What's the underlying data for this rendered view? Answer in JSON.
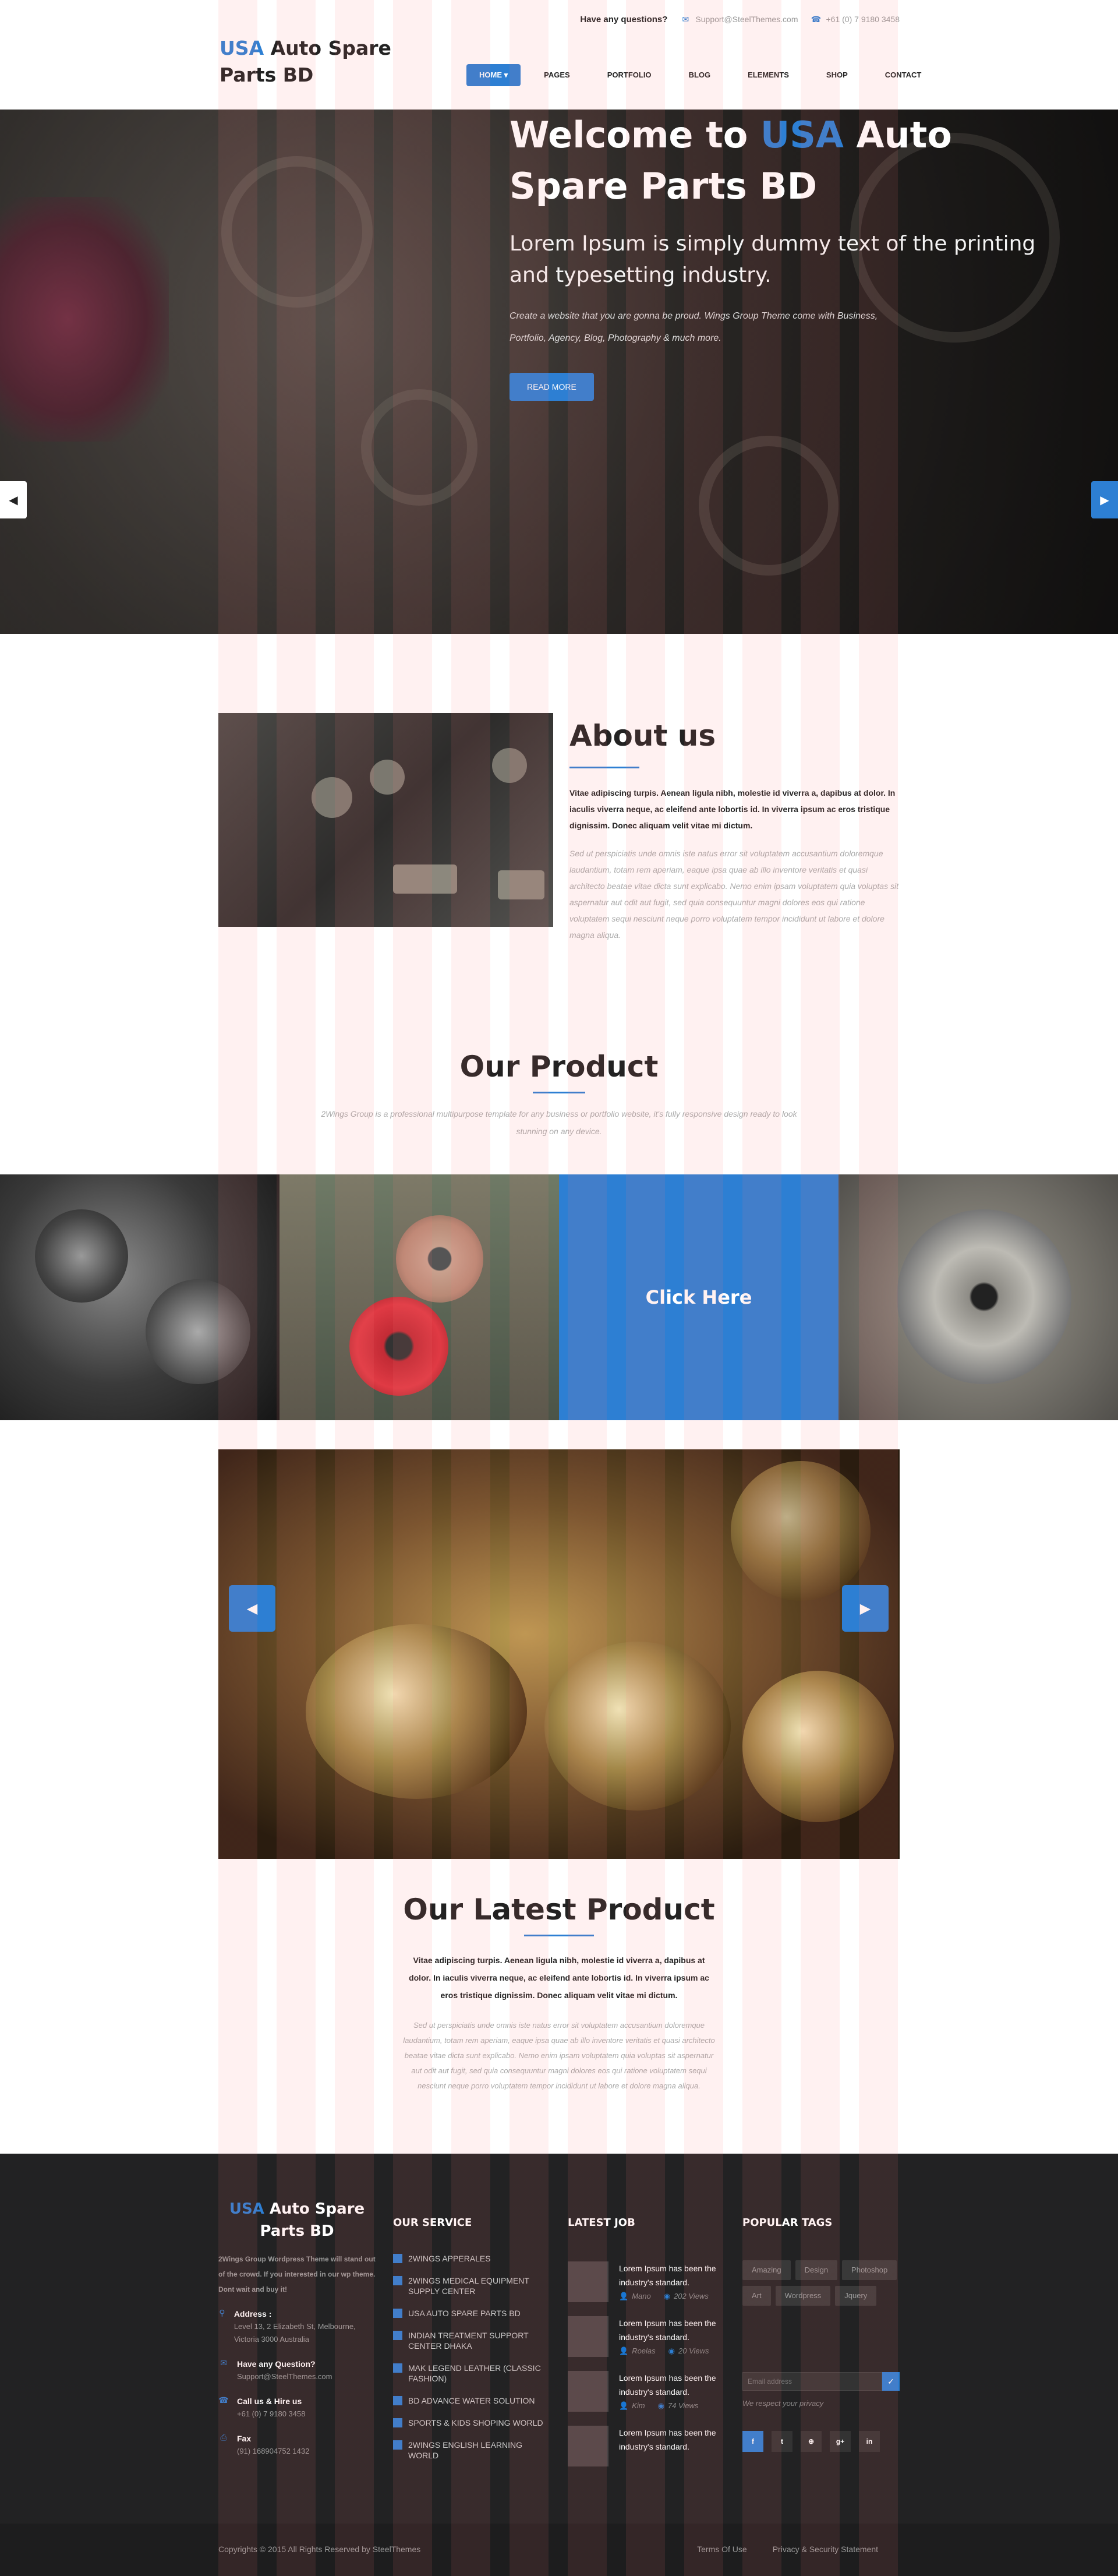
{
  "header": {
    "question": "Have any questions?",
    "email": "Support@SteelThemes.com",
    "phone": "+61 (0) 7 9180 3458",
    "logo_accent": "USA",
    "logo_rest": " Auto Spare Parts BD",
    "nav": [
      {
        "label": "HOME",
        "active": true
      },
      {
        "label": "PAGES"
      },
      {
        "label": "PORTFOLIO"
      },
      {
        "label": "BLOG"
      },
      {
        "label": "ELEMENTS"
      },
      {
        "label": "SHOP"
      },
      {
        "label": "CONTACT"
      }
    ]
  },
  "hero": {
    "title_prefix": "Welcome to ",
    "title_accent": "USA",
    "title_rest": " Auto Spare Parts BD",
    "lead": "Lorem Ipsum is simply dummy text of the printing and typesetting industry.",
    "small": "Create a website that you are gonna be proud. Wings Group Theme come with Business, Portfolio, Agency, Blog, Photography & much more.",
    "button": "READ MORE"
  },
  "about": {
    "title": "About us",
    "bold": "Vitae adipiscing turpis. Aenean ligula nibh, molestie id viverra a, dapibus at dolor. In iaculis viverra neque, ac eleifend ante lobortis id. In viverra ipsum ac eros tristique dignissim. Donec aliquam velit vitae mi dictum.",
    "muted": "Sed ut perspiciatis unde omnis iste natus error sit voluptatem accusantium doloremque laudantium, totam rem aperiam, eaque ipsa quae ab illo inventore veritatis et quasi architecto beatae vitae dicta sunt explicabo. Nemo enim ipsam voluptatem quia voluptas sit aspernatur aut odit aut fugit, sed quia consequuntur magni dolores eos qui ratione voluptatem sequi nesciunt neque porro voluptatem tempor incididunt ut labore et dolore magna aliqua."
  },
  "product": {
    "title": "Our Product",
    "subtitle": "2Wings Group is a professional multipurpose template for any business or portfolio website, it's fully responsive design ready to look stunning on any device.",
    "click_here": "Click Here"
  },
  "latest": {
    "title": "Our Latest Product",
    "bold": "Vitae adipiscing turpis. Aenean ligula nibh, molestie id viverra a, dapibus at dolor. In iaculis viverra neque, ac eleifend ante lobortis id. In viverra ipsum ac eros tristique dignissim. Donec aliquam velit vitae mi dictum.",
    "muted": "Sed ut perspiciatis unde omnis iste natus error sit voluptatem accusantium doloremque laudantium, totam rem aperiam, eaque ipsa quae ab illo inventore veritatis et quasi architecto beatae vitae dicta sunt explicabo. Nemo enim ipsam voluptatem quia voluptas sit aspernatur aut odit aut fugit, sed quia consequuntur magni dolores eos qui ratione voluptatem sequi nesciunt neque porro voluptatem tempor incididunt ut labore et dolore magna aliqua."
  },
  "footer": {
    "logo_accent": "USA",
    "logo_rest": " Auto Spare Parts BD",
    "about": "2Wings Group Wordpress Theme will stand out of the crowd. If you interested in our wp theme. Dont wait and buy it!",
    "address_label": "Address :",
    "address": "Level 13, 2 Elizabeth St, Melbourne, Victoria 3000 Australia",
    "question_label": "Have any Question?",
    "question_email": "Support@SteelThemes.com",
    "call_label": "Call us & Hire us",
    "call_value": "+61 (0) 7 9180 3458",
    "fax_label": "Fax",
    "fax_value": "(91) 168904752 1432",
    "service_title": "OUR SERVICE",
    "services": [
      "2WINGS APPERALES",
      "2WINGS MEDICAL EQUIPMENT SUPPLY CENTER",
      "USA AUTO SPARE PARTS BD",
      "INDIAN TREATMENT SUPPORT CENTER DHAKA",
      "MAK LEGEND LEATHER (CLASSIC FASHION)",
      "BD ADVANCE WATER SOLUTION",
      "SPORTS & KIDS SHOPING WORLD",
      "2WINGS ENGLISH LEARNING WORLD"
    ],
    "jobs_title": "LATEST JOB",
    "jobs": [
      {
        "text": "Lorem Ipsum has been the industry's standard.",
        "author": "Mano",
        "views": "202 Views"
      },
      {
        "text": "Lorem Ipsum has been the industry's standard.",
        "author": "Roelas",
        "views": "20 Views"
      },
      {
        "text": "Lorem Ipsum has been the industry's standard.",
        "author": "Kim",
        "views": "74 Views"
      },
      {
        "text": "Lorem Ipsum has been the industry's standard.",
        "author": "",
        "views": ""
      }
    ],
    "tags_title": "POPULAR TAGS",
    "tags": [
      "Amazing",
      "Design",
      "Photoshop",
      "Art",
      "Wordpress",
      "Jquery"
    ],
    "subscribe_placeholder": "Email address",
    "privacy": "We respect your privacy",
    "socials": [
      "f",
      "t",
      "⊕",
      "g+",
      "in"
    ],
    "copyright": "Copyrights © 2015 All Rights Reserved by SteelThemes",
    "links": [
      "Terms Of Use",
      "Privacy & Security Statement"
    ]
  }
}
